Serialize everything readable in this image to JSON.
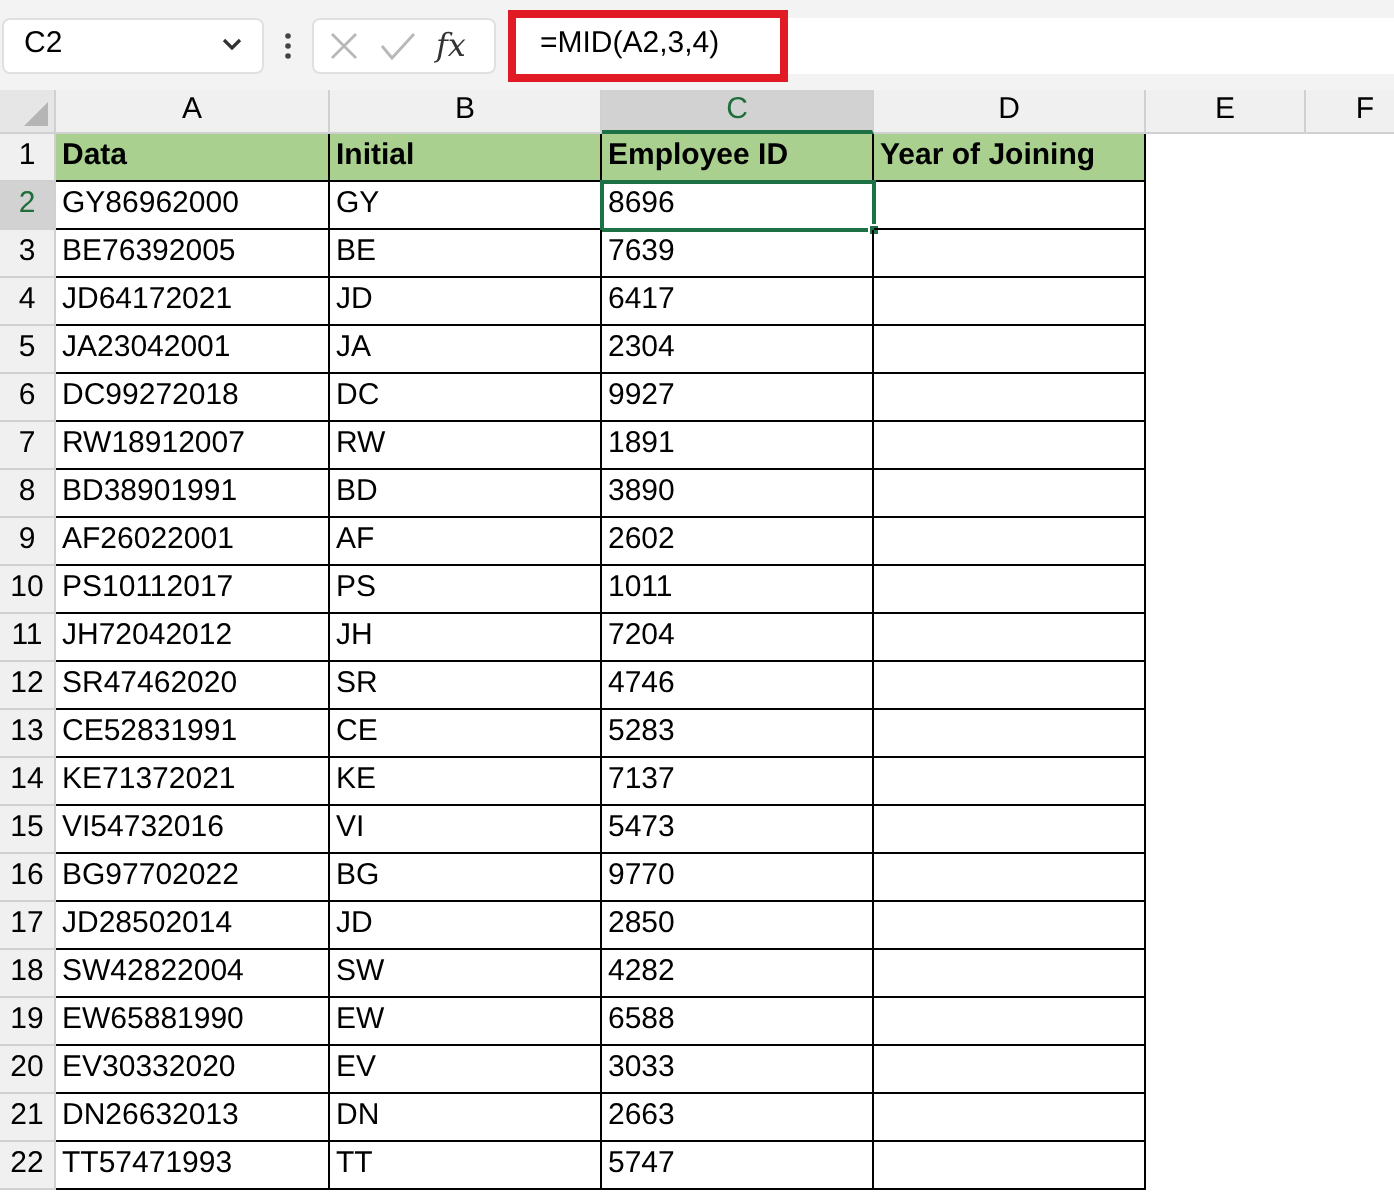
{
  "name_box": {
    "value": "C2"
  },
  "formula_bar": {
    "fx_label": "fx",
    "formula": "=MID(A2,3,4)",
    "highlighted": true
  },
  "columns": [
    {
      "label": "A",
      "selected": false
    },
    {
      "label": "B",
      "selected": false
    },
    {
      "label": "C",
      "selected": true
    },
    {
      "label": "D",
      "selected": false
    },
    {
      "label": "E",
      "selected": false
    },
    {
      "label": "F",
      "selected": false
    }
  ],
  "rows": [
    {
      "number": "1",
      "kind": "header",
      "selected": false,
      "cells": [
        "Data",
        "Initial",
        "Employee ID",
        "Year of Joining"
      ]
    },
    {
      "number": "2",
      "kind": "data",
      "selected": true,
      "cells": [
        "GY86962000",
        "GY",
        "8696",
        ""
      ]
    },
    {
      "number": "3",
      "kind": "data",
      "selected": false,
      "cells": [
        "BE76392005",
        "BE",
        "7639",
        ""
      ]
    },
    {
      "number": "4",
      "kind": "data",
      "selected": false,
      "cells": [
        "JD64172021",
        "JD",
        "6417",
        ""
      ]
    },
    {
      "number": "5",
      "kind": "data",
      "selected": false,
      "cells": [
        "JA23042001",
        "JA",
        "2304",
        ""
      ]
    },
    {
      "number": "6",
      "kind": "data",
      "selected": false,
      "cells": [
        "DC99272018",
        "DC",
        "9927",
        ""
      ]
    },
    {
      "number": "7",
      "kind": "data",
      "selected": false,
      "cells": [
        "RW18912007",
        "RW",
        "1891",
        ""
      ]
    },
    {
      "number": "8",
      "kind": "data",
      "selected": false,
      "cells": [
        "BD38901991",
        "BD",
        "3890",
        ""
      ]
    },
    {
      "number": "9",
      "kind": "data",
      "selected": false,
      "cells": [
        "AF26022001",
        "AF",
        "2602",
        ""
      ]
    },
    {
      "number": "10",
      "kind": "data",
      "selected": false,
      "cells": [
        "PS10112017",
        "PS",
        "1011",
        ""
      ]
    },
    {
      "number": "11",
      "kind": "data",
      "selected": false,
      "cells": [
        "JH72042012",
        "JH",
        "7204",
        ""
      ]
    },
    {
      "number": "12",
      "kind": "data",
      "selected": false,
      "cells": [
        "SR47462020",
        "SR",
        "4746",
        ""
      ]
    },
    {
      "number": "13",
      "kind": "data",
      "selected": false,
      "cells": [
        "CE52831991",
        "CE",
        "5283",
        ""
      ]
    },
    {
      "number": "14",
      "kind": "data",
      "selected": false,
      "cells": [
        "KE71372021",
        "KE",
        "7137",
        ""
      ]
    },
    {
      "number": "15",
      "kind": "data",
      "selected": false,
      "cells": [
        "VI54732016",
        "VI",
        "5473",
        ""
      ]
    },
    {
      "number": "16",
      "kind": "data",
      "selected": false,
      "cells": [
        "BG97702022",
        "BG",
        "9770",
        ""
      ]
    },
    {
      "number": "17",
      "kind": "data",
      "selected": false,
      "cells": [
        "JD28502014",
        "JD",
        "2850",
        ""
      ]
    },
    {
      "number": "18",
      "kind": "data",
      "selected": false,
      "cells": [
        "SW42822004",
        "SW",
        "4282",
        ""
      ]
    },
    {
      "number": "19",
      "kind": "data",
      "selected": false,
      "cells": [
        "EW65881990",
        "EW",
        "6588",
        ""
      ]
    },
    {
      "number": "20",
      "kind": "data",
      "selected": false,
      "cells": [
        "EV30332020",
        "EV",
        "3033",
        ""
      ]
    },
    {
      "number": "21",
      "kind": "data",
      "selected": false,
      "cells": [
        "DN26632013",
        "DN",
        "2663",
        ""
      ]
    },
    {
      "number": "22",
      "kind": "data",
      "selected": false,
      "cells": [
        "TT57471993",
        "TT",
        "5747",
        ""
      ]
    }
  ]
}
